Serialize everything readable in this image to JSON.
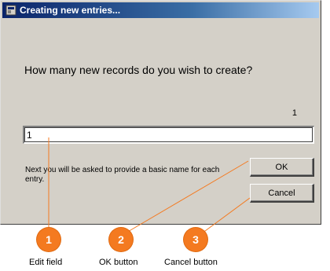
{
  "dialog": {
    "title": "Creating new entries...",
    "question": "How many new records do you wish to create?",
    "count_label": "1",
    "edit_value": "1",
    "hint": "Next you will be asked to provide a basic name for each entry.",
    "ok_label": "OK",
    "cancel_label": "Cancel"
  },
  "callouts": [
    {
      "number": "1",
      "caption": "Edit field"
    },
    {
      "number": "2",
      "caption": "OK button"
    },
    {
      "number": "3",
      "caption": "Cancel button"
    }
  ],
  "colors": {
    "titlebar_start": "#0a246a",
    "titlebar_end": "#a6caf0",
    "dialog_face": "#d4d0c8",
    "callout_accent": "#f47a20"
  }
}
